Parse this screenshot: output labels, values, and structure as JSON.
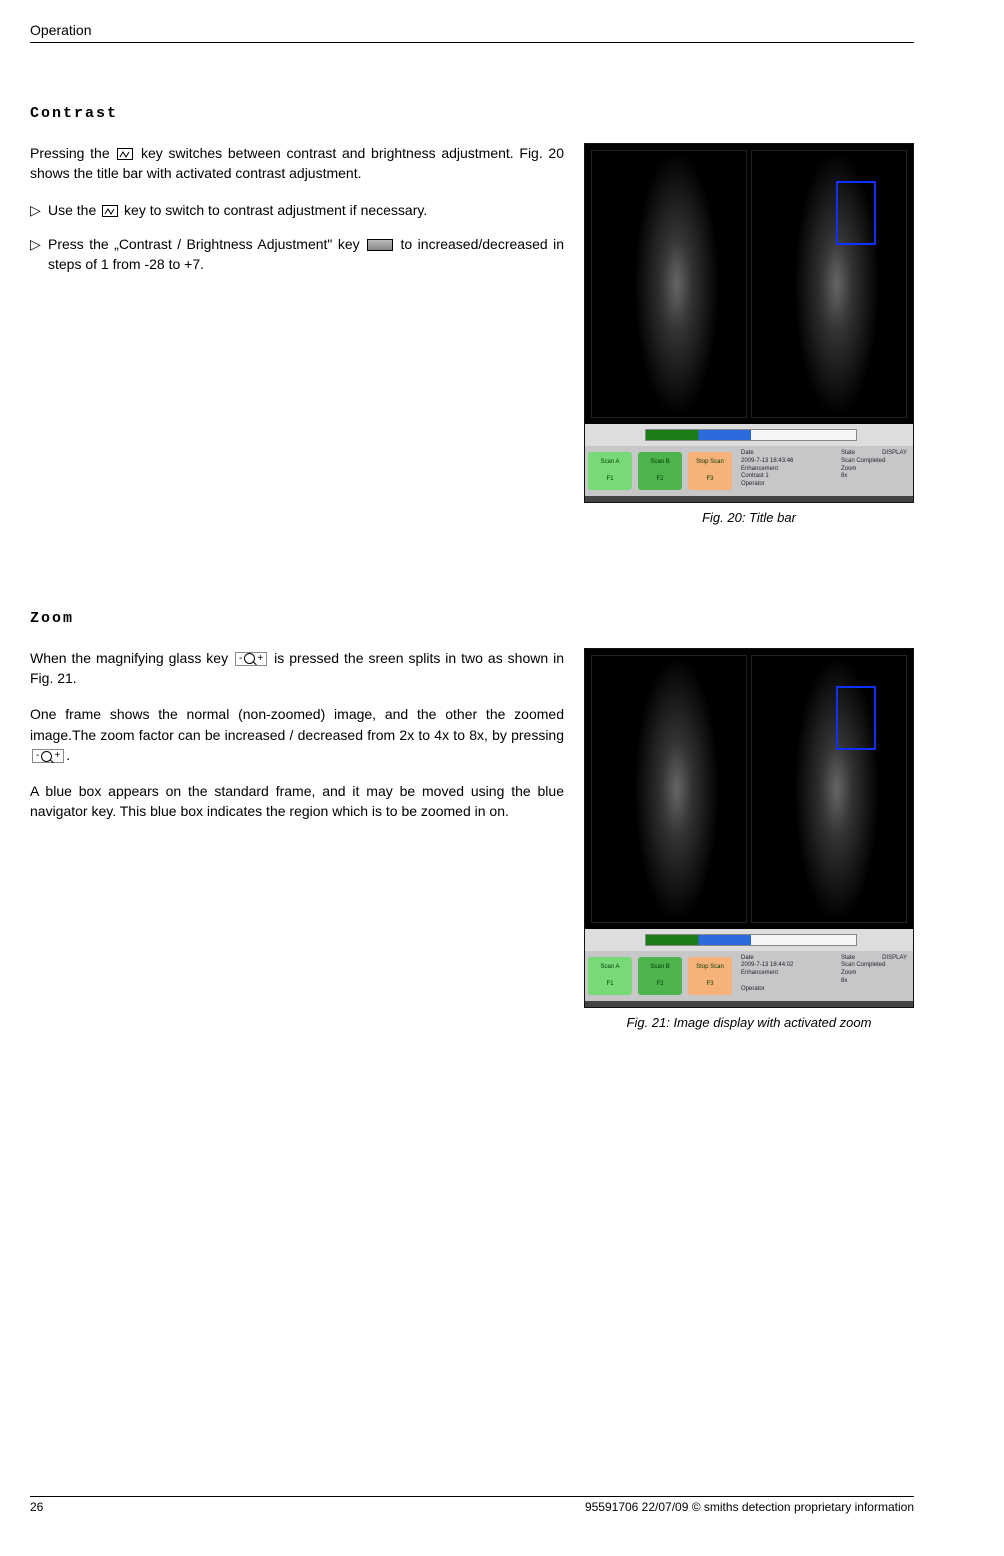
{
  "header": {
    "chapter": "Operation"
  },
  "section1": {
    "title": "Contrast",
    "p1_a": "Pressing the ",
    "p1_b": " key switches between contrast and brightness adjustment. Fig. 20 shows the title bar with activated contrast adjustment.",
    "bullet1_a": "Use the ",
    "bullet1_b": " key to switch to contrast adjustment if necessary.",
    "bullet2_a": "Press the „Contrast / Brightness Adjustment\" key ",
    "bullet2_b": " to increased/decreased in steps of 1 from -28 to +7.",
    "caption": "Fig. 20: Title bar"
  },
  "section2": {
    "title": "Zoom",
    "p1_a": "When the magnifying glass key ",
    "p1_b": " is pressed the sreen splits in two as shown in Fig. 21.",
    "p2_a": "One frame shows the normal (non-zoomed) image, and the other the zoomed image.The zoom factor can be increased / decreased from 2x to 4x to 8x, by pressing ",
    "p2_b": ".",
    "p3": "A blue box appears on the standard frame, and it may be moved using the blue navigator key. This blue box indicates the region which is to be zoomed in on.",
    "caption": "Fig. 21: Image display with activated zoom"
  },
  "screenshot1": {
    "btn1": "Scan A\\n\\nF1",
    "btn2": "Scan B\\n\\nF2",
    "btn3": "Stop Scan\\n\\nF3",
    "info": {
      "date_label": "Date",
      "date_value": "2009-7-13 18:43:46",
      "enh_label": "Enhancement",
      "contrast": "Contrast 1",
      "op_label": "Operator",
      "state_label": "State",
      "state_value": "Scan Completed",
      "zoom_label": "Zoom",
      "zoom_value": "8x",
      "disp": "DISPLAY"
    }
  },
  "screenshot2": {
    "btn1": "Scan A\\n\\nF1",
    "btn2": "Scan B\\n\\nF2",
    "btn3": "Stop Scan\\n\\nF3",
    "info": {
      "date_label": "Date",
      "date_value": "2009-7-13 18:44:02",
      "enh_label": "Enhancement",
      "op_label": "Operator",
      "state_label": "State",
      "state_value": "Scan Completed",
      "zoom_label": "Zoom",
      "zoom_value": "8x",
      "disp": "DISPLAY"
    }
  },
  "footer": {
    "page": "26",
    "right": "95591706 22/07/09 © smiths detection proprietary information"
  },
  "chart_data": null
}
